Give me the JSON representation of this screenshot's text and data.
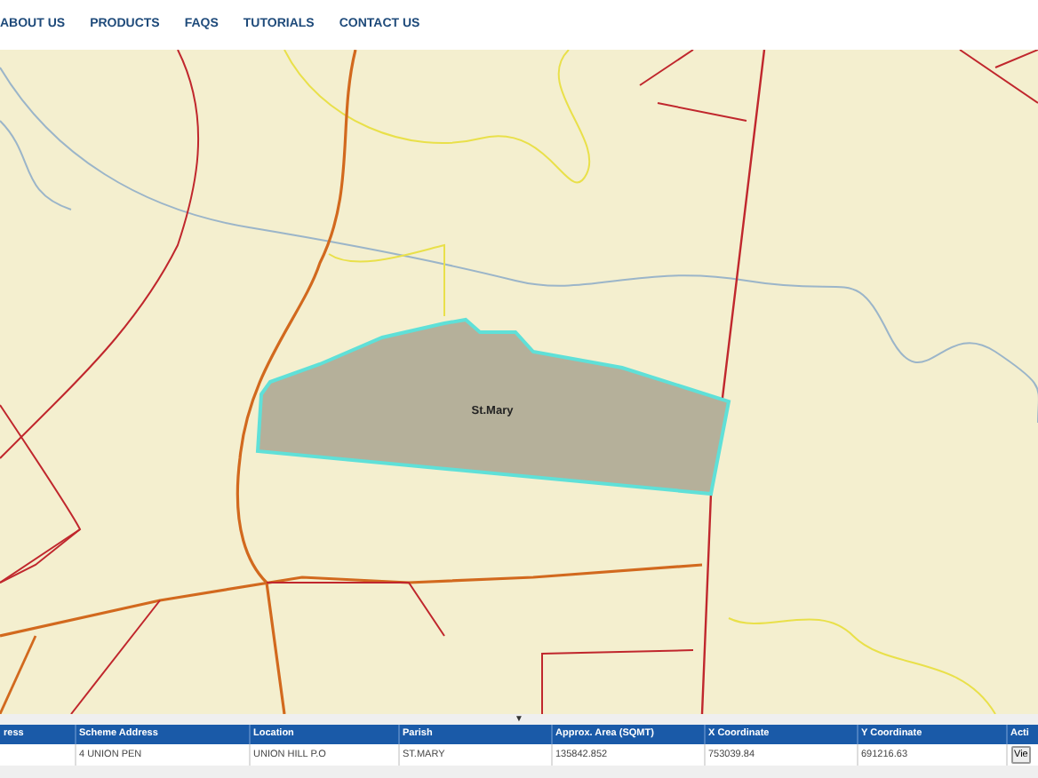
{
  "nav": {
    "items": [
      "ABOUT US",
      "PRODUCTS",
      "FAQS",
      "TUTORIALS",
      "CONTACT US"
    ]
  },
  "map": {
    "parcel_label": "St.Mary"
  },
  "panel": {
    "toggle": "▼"
  },
  "table": {
    "columns": [
      "ress",
      "Scheme Address",
      "Location",
      "Parish",
      "Approx. Area (SQMT)",
      "X Coordinate",
      "Y Coordinate",
      "Acti"
    ],
    "rows": [
      {
        "cells": [
          "",
          "4 UNION PEN",
          "UNION HILL P.O",
          "ST.MARY",
          "135842.852",
          "753039.84",
          "691216.63"
        ],
        "action": "Vie"
      }
    ]
  }
}
